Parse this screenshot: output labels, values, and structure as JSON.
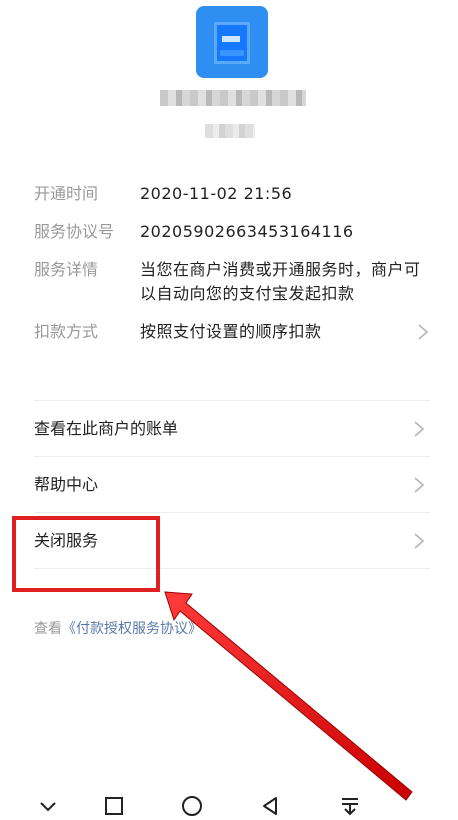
{
  "header": {
    "icon": "merchant-app-icon",
    "merchant_name_blurred": true,
    "merchant_sub_blurred": true
  },
  "info": {
    "rows": [
      {
        "label": "开通时间",
        "value": "2020-11-02 21:56"
      },
      {
        "label": "服务协议号",
        "value": "20205902663453164116"
      },
      {
        "label": "服务详情",
        "value": "当您在商户消费或开通服务时，商户可以自动向您的支付宝发起扣款"
      },
      {
        "label": "扣款方式",
        "value": "按照支付设置的顺序扣款"
      }
    ]
  },
  "menu": {
    "items": [
      {
        "label": "查看在此商户的账单"
      },
      {
        "label": "帮助中心"
      },
      {
        "label": "关闭服务"
      }
    ]
  },
  "agreement": {
    "prefix": "查看",
    "link": "《付款授权服务协议》"
  },
  "annotation": {
    "box_color": "#e02020",
    "arrow_color": "#e02020"
  },
  "navbar": {
    "icons": [
      "chevron-down-icon",
      "square-icon",
      "circle-icon",
      "triangle-back-icon",
      "download-drawer-icon"
    ]
  }
}
